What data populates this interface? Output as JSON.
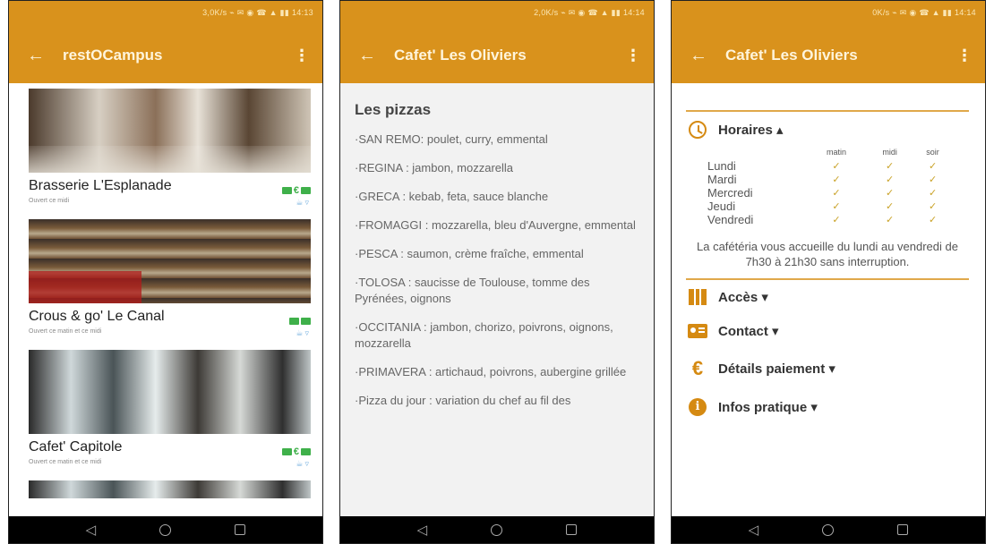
{
  "colors": {
    "accent": "#d9921c",
    "check": "#c9a227",
    "payment_icon": "#3fb04a"
  },
  "status_bars": {
    "s1": "3,0K/s ⌁ ✉ ◉ ☎ ▲ ▮▮ 14:13",
    "s2": "2,0K/s ⌁ ✉ ◉ ☎ ▲ ▮▮ 14:14",
    "s3": "0K/s ⌁ ✉ ◉ ☎ ▲ ▮▮ 14:14"
  },
  "screen1": {
    "title": "restOCampus",
    "back_icon": "arrow-left-icon",
    "menu_icon": "more-vert-icon",
    "cards": [
      {
        "name": "Brasserie L'Esplanade",
        "status": "Ouvert ce midi"
      },
      {
        "name": "Crous & go' Le Canal",
        "status": "Ouvert ce matin et ce midi"
      },
      {
        "name": "Cafet' Capitole",
        "status": "Ouvert ce matin et ce midi"
      }
    ]
  },
  "screen2": {
    "title": "Cafet' Les Oliviers",
    "section": "Les pizzas",
    "pizzas": [
      "·SAN REMO: poulet, curry, emmental",
      "·REGINA : jambon, mozzarella",
      "·GRECA : kebab, feta, sauce blanche",
      "·FROMAGGI : mozzarella, bleu d'Auvergne, emmental",
      "·PESCA : saumon, crème fraîche, emmental",
      "·TOLOSA : saucisse de Toulouse, tomme des Pyrénées, oignons",
      "·OCCITANIA : jambon, chorizo, poivrons, oignons, mozzarella",
      "·PRIMAVERA : artichaud, poivrons, aubergine grillée",
      "·Pizza du jour : variation du chef au fil des"
    ]
  },
  "screen3": {
    "title": "Cafet' Les Oliviers",
    "horaires": "Horaires ▴",
    "columns": [
      "matin",
      "midi",
      "soir"
    ],
    "days": [
      "Lundi",
      "Mardi",
      "Mercredi",
      "Jeudi",
      "Vendredi"
    ],
    "check": "✓",
    "note": "La cafétéria vous accueille du lundi au vendredi de 7h30 à 21h30 sans interruption.",
    "acces": "Accès ▾",
    "contact": "Contact ▾",
    "paiement": "Détails paiement ▾",
    "infos": "Infos pratique ▾",
    "euro_symbol": "€",
    "info_symbol": "i"
  },
  "nav": {
    "back": "◁"
  }
}
